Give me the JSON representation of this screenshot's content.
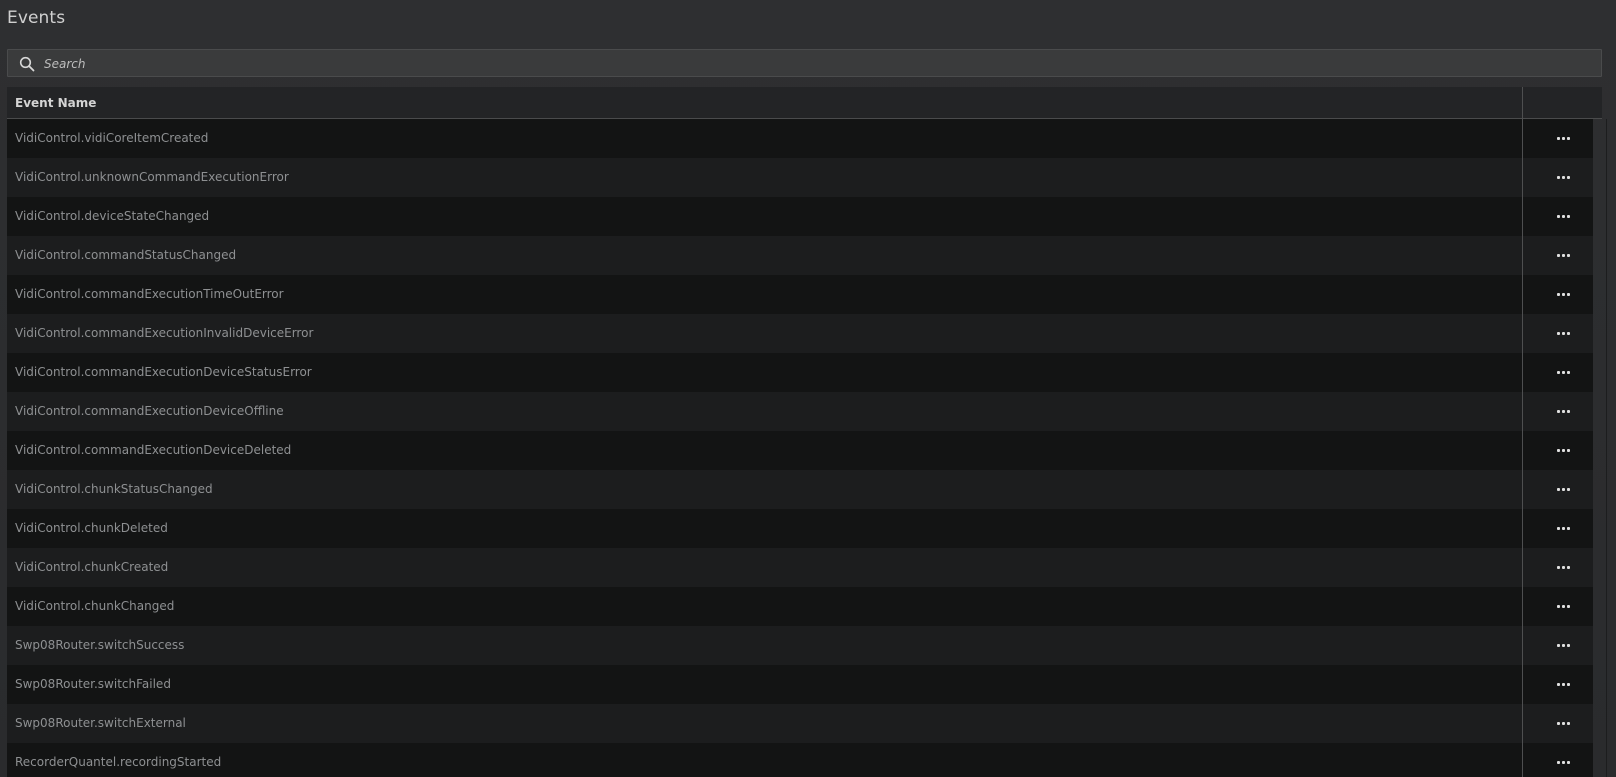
{
  "page": {
    "title": "Events"
  },
  "search": {
    "placeholder": "Search",
    "value": ""
  },
  "table": {
    "columns": {
      "name": "Event Name",
      "actions": ""
    },
    "rows": [
      {
        "name": "VidiControl.vidiCoreItemCreated"
      },
      {
        "name": "VidiControl.unknownCommandExecutionError"
      },
      {
        "name": "VidiControl.deviceStateChanged"
      },
      {
        "name": "VidiControl.commandStatusChanged"
      },
      {
        "name": "VidiControl.commandExecutionTimeOutError"
      },
      {
        "name": "VidiControl.commandExecutionInvalidDeviceError"
      },
      {
        "name": "VidiControl.commandExecutionDeviceStatusError"
      },
      {
        "name": "VidiControl.commandExecutionDeviceOffline"
      },
      {
        "name": "VidiControl.commandExecutionDeviceDeleted"
      },
      {
        "name": "VidiControl.chunkStatusChanged"
      },
      {
        "name": "VidiControl.chunkDeleted"
      },
      {
        "name": "VidiControl.chunkCreated"
      },
      {
        "name": "VidiControl.chunkChanged"
      },
      {
        "name": "Swp08Router.switchSuccess"
      },
      {
        "name": "Swp08Router.switchFailed"
      },
      {
        "name": "Swp08Router.switchExternal"
      },
      {
        "name": "RecorderQuantel.recordingStarted"
      }
    ],
    "row_menu_icon": "more-horizontal-icon"
  },
  "colors": {
    "background": "#2b2c2e",
    "row_odd": "#131414",
    "row_even": "#1c1d1e",
    "text_muted": "#8e9092",
    "header_text": "#d4d4d4"
  }
}
